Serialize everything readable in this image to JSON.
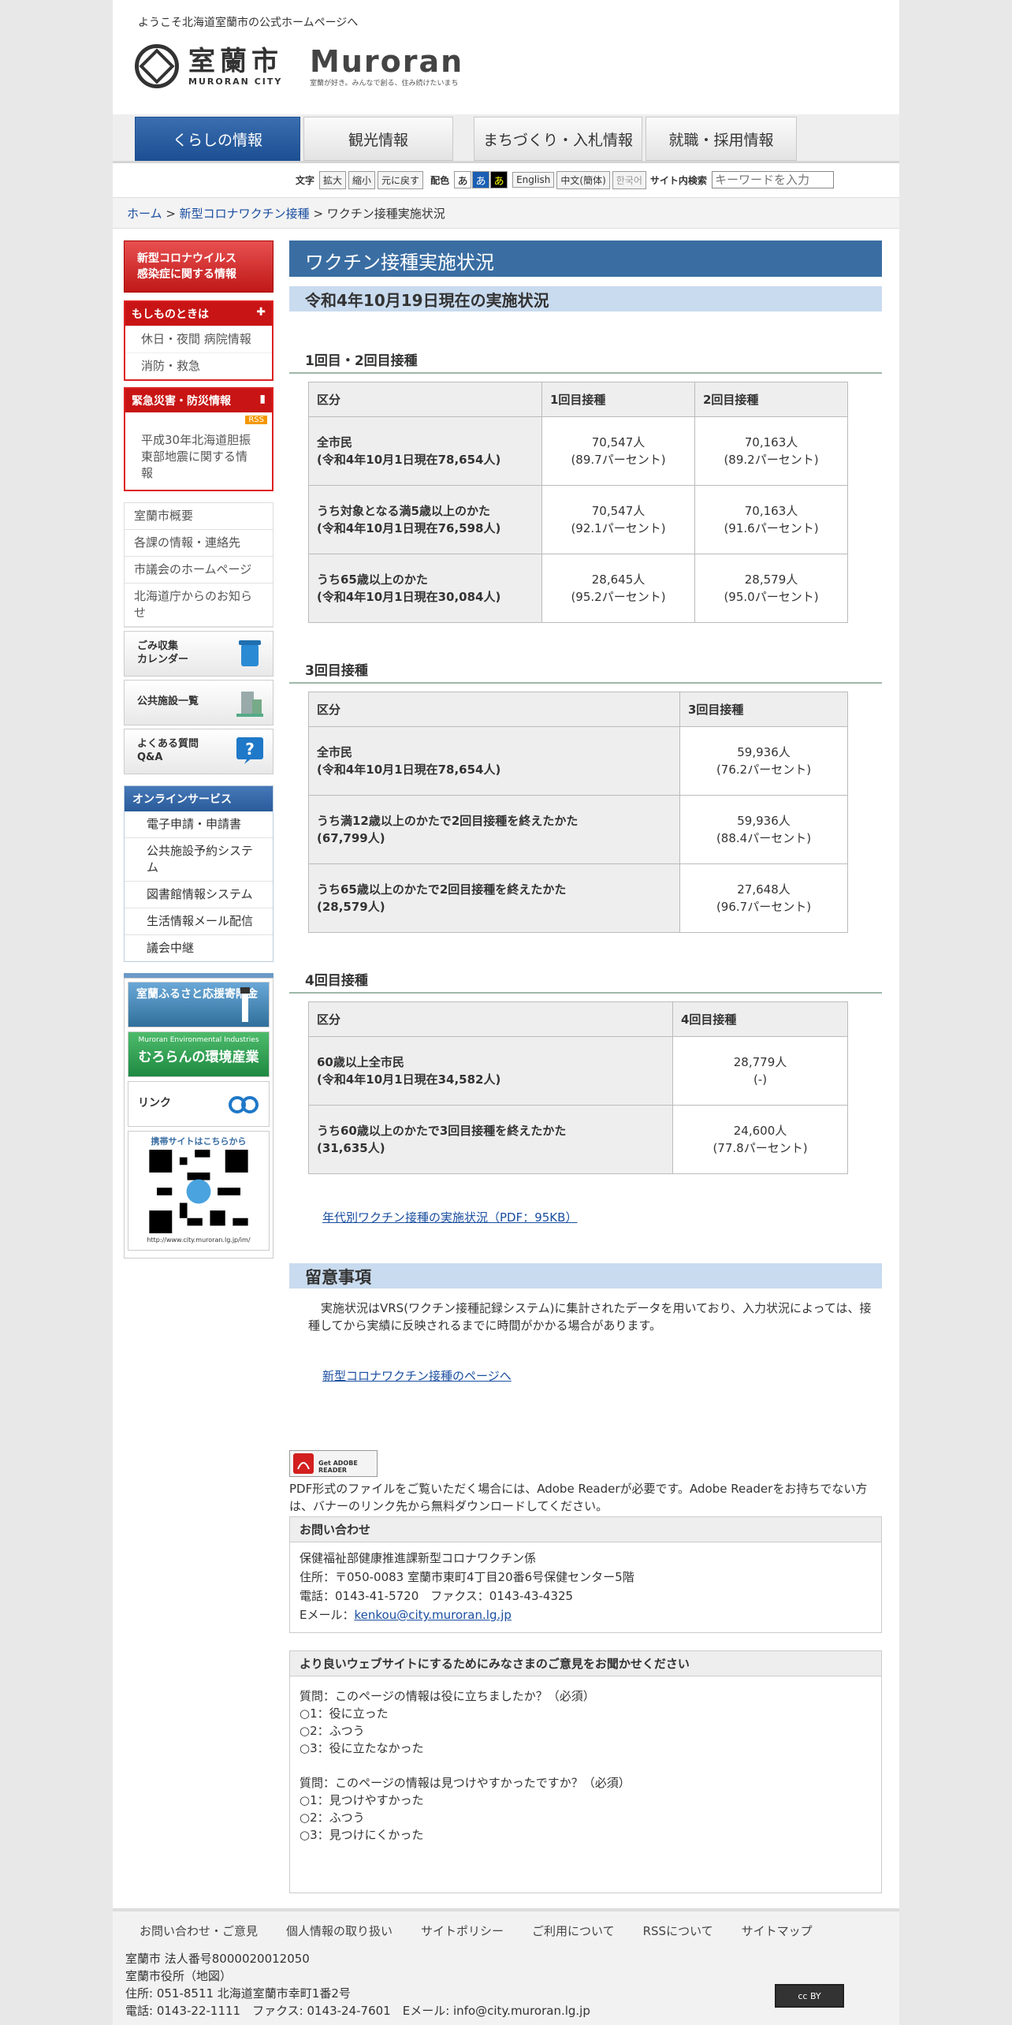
{
  "header": {
    "welcome": "ようこそ北海道室蘭市の公式ホームページへ",
    "logo_jp": "室蘭市",
    "logo_en": "MURORAN CITY",
    "brand_word": "Muroran",
    "brand_tagline": "室蘭が好き。みんなで創る、住み続けたいまち"
  },
  "nav": [
    "くらしの情報",
    "観光情報",
    "まちづくり・入札情報",
    "就職・採用情報"
  ],
  "toolbar": {
    "text_label": "文字",
    "enlarge": "拡大",
    "shrink": "縮小",
    "reset": "元に戻す",
    "color_label": "配色",
    "color_glyph": "あ",
    "english": "English",
    "chinese": "中文(簡体)",
    "korean": "한국어",
    "search_label": "サイト内検索",
    "search_placeholder": "キーワードを入力"
  },
  "breadcrumb": {
    "home": "ホーム",
    "sep": " > ",
    "parent": "新型コロナワクチン接種",
    "current": "ワクチン接種実施状況"
  },
  "sidebar": {
    "covid_line1": "新型コロナウイルス",
    "covid_line2": "感染症に関する情報",
    "emergency_title": "もしものときは",
    "emergency_items": [
      "休日・夜間 病院情報",
      "消防・救急"
    ],
    "disaster_title": "緊急災害・防災情報",
    "rss": "RSS",
    "disaster_items": [
      "平成30年北海道胆振東部地震に関する情報"
    ],
    "list": [
      "室蘭市概要",
      "各課の情報・連絡先",
      "市議会のホームページ",
      "北海道庁からのお知らせ"
    ],
    "features": [
      {
        "l1": "ごみ収集",
        "l2": "カレンダー"
      },
      {
        "l1": "公共施設一覧",
        "l2": ""
      },
      {
        "l1": "よくある質問",
        "l2": "Q&A"
      }
    ],
    "online_title": "オンラインサービス",
    "online_items": [
      "電子申請・申請書",
      "公共施設予約システム",
      "図書館情報システム",
      "生活情報メール配信",
      "議会中継"
    ],
    "banner_furusato": "室蘭ふるさと応援寄附金",
    "banner_env_en": "Muroran Environmental Industries",
    "banner_env_jp": "むろらんの環境産業",
    "banner_link": "リンク",
    "mobile_text": "携帯サイトはこちらから",
    "mobile_url": "http://www.city.muroran.lg.jp/im/"
  },
  "main": {
    "title": "ワクチン接種実施状況",
    "subtitle": "令和4年10月19日現在の実施状況",
    "sec1": {
      "heading": "1回目・2回目接種",
      "headers": [
        "区分",
        "1回目接種",
        "2回目接種"
      ],
      "rows": [
        {
          "l1": "全市民",
          "l2": "(令和4年10月1日現在78,654人)",
          "a1": "70,547人",
          "a2": "(89.7パーセント)",
          "b1": "70,163人",
          "b2": "(89.2パーセント)"
        },
        {
          "l1": "うち対象となる満5歳以上のかた",
          "l2": "(令和4年10月1日現在76,598人)",
          "a1": "70,547人",
          "a2": "(92.1パーセント)",
          "b1": "70,163人",
          "b2": "(91.6パーセント)"
        },
        {
          "l1": "うち65歳以上のかた",
          "l2": "(令和4年10月1日現在30,084人)",
          "a1": "28,645人",
          "a2": "(95.2パーセント)",
          "b1": "28,579人",
          "b2": "(95.0パーセント)"
        }
      ]
    },
    "sec2": {
      "heading": "3回目接種",
      "headers": [
        "区分",
        "3回目接種"
      ],
      "rows": [
        {
          "l1": "全市民",
          "l2": "(令和4年10月1日現在78,654人)",
          "a1": "59,936人",
          "a2": "(76.2パーセント)"
        },
        {
          "l1": "うち満12歳以上のかたで2回目接種を終えたかた",
          "l2": "(67,799人)",
          "a1": "59,936人",
          "a2": "(88.4パーセント)"
        },
        {
          "l1": "うち65歳以上のかたで2回目接種を終えたかた",
          "l2": "(28,579人)",
          "a1": "27,648人",
          "a2": "(96.7パーセント)"
        }
      ]
    },
    "sec3": {
      "heading": "4回目接種",
      "headers": [
        "区分",
        "4回目接種"
      ],
      "rows": [
        {
          "l1": "60歳以上全市民",
          "l2": "(令和4年10月1日現在34,582人)",
          "a1": "28,779人",
          "a2": "(-)"
        },
        {
          "l1": "うち60歳以上のかたで3回目接種を終えたかた",
          "l2": "(31,635人)",
          "a1": "24,600人",
          "a2": "(77.8パーセント)"
        }
      ]
    },
    "pdf_link": "年代別ワクチン接種の実施状況（PDF：95KB）",
    "notes_title": "留意事項",
    "notes_text": "実施状況はVRS(ワクチン接種記録システム)に集計されたデータを用いており、入力状況によっては、接種してから実績に反映されるまでに時間がかかる場合があります。",
    "back_link": "新型コロナワクチン接種のページへ",
    "adobe_banner": "Get ADOBE READER",
    "adobe_note": "PDF形式のファイルをご覧いただく場合には、Adobe Readerが必要です。Adobe Readerをお持ちでない方は、バナーのリンク先から無料ダウンロードしてください。"
  },
  "contact": {
    "title": "お問い合わせ",
    "dept": "保健福祉部健康推進課新型コロナワクチン係",
    "address": "住所：〒050-0083 室蘭市東町4丁目20番6号保健センター5階",
    "phone": "電話：0143-41-5720　ファクス：0143-43-4325",
    "email_label": "Eメール：",
    "email": "kenkou@city.muroran.lg.jp"
  },
  "survey": {
    "title": "より良いウェブサイトにするためにみなさまのご意見をお聞かせください",
    "q1": "質問：このページの情報は役に立ちましたか？（必須）",
    "q1_options": [
      "1：役に立った",
      "2：ふつう",
      "3：役に立たなかった"
    ],
    "q2": "質問：このページの情報は見つけやすかったですか？（必須）",
    "q2_options": [
      "1：見つけやすかった",
      "2：ふつう",
      "3：見つけにくかった"
    ]
  },
  "footer": {
    "links": [
      "お問い合わせ・ご意見",
      "個人情報の取り扱い",
      "サイトポリシー",
      "ご利用について",
      "RSSについて",
      "サイトマップ"
    ],
    "corp_no": "室蘭市 法人番号8000020012050",
    "office": "室蘭市役所（地図）",
    "address": "住所: 051-8511 北海道室蘭市幸町1番2号",
    "contact": "電話: 0143-22-1111　ファクス: 0143-24-7601　Eメール: info@city.muroran.lg.jp",
    "cc": "cc BY"
  },
  "colors": {
    "accent": "#3a6ea3",
    "nav_active": "#1c4f93",
    "alert_red": "#c81414"
  }
}
